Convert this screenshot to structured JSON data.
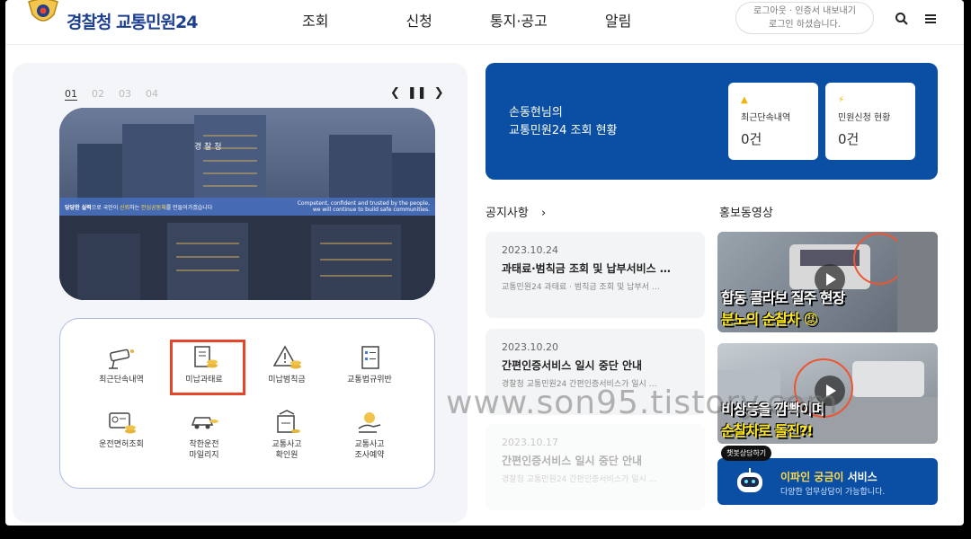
{
  "header": {
    "logo_text": "경찰청 교통민원24",
    "nav": [
      "조회",
      "신청",
      "통지·공고",
      "알림"
    ],
    "login_line1": "로그아웃 · 인증서 내보내기",
    "login_line2": "로그인 하셨습니다."
  },
  "slider": {
    "numbers": [
      "01",
      "02",
      "03",
      "04"
    ],
    "banner_building": "경 찰 청",
    "banner_left_plain1": "당당한 실력",
    "banner_left_plain2": "으로 국민이 ",
    "banner_left_hl1": "신뢰",
    "banner_left_plain3": "하는 ",
    "banner_left_hl2": "안심공동체",
    "banner_left_plain4": "를 만들어가겠습니다",
    "banner_right_1": "Competent, confident and trusted by the people,",
    "banner_right_2": "we will continue to build safe communities."
  },
  "menu": [
    {
      "l1": "최근단속내역",
      "l2": ""
    },
    {
      "l1": "미납과태료",
      "l2": ""
    },
    {
      "l1": "미납범칙금",
      "l2": ""
    },
    {
      "l1": "교통법규위반",
      "l2": ""
    },
    {
      "l1": "운전면허조회",
      "l2": ""
    },
    {
      "l1": "착한운전",
      "l2": "마일리지"
    },
    {
      "l1": "교통사고",
      "l2": "확인원"
    },
    {
      "l1": "교통사고",
      "l2": "조사예약"
    }
  ],
  "status": {
    "line1": "손동현님의",
    "line2": "교통민원24 조회 현황",
    "box1_label": "최근단속내역",
    "box1_value": "0건",
    "box2_label": "민원신청 현황",
    "box2_value": "0건"
  },
  "notices_title": "공지사항",
  "notices": [
    {
      "date": "2023.10.24",
      "title": "과태료·범칙금 조회 및 납부서비스 …",
      "summary": "교통민원24 과태료 · 범칙금 조회 및 납부서 …"
    },
    {
      "date": "2023.10.20",
      "title": "간편인증서비스 일시 중단 안내",
      "summary": "경찰청 교통민원24 간편인증서비스가 일시 …"
    },
    {
      "date": "2023.10.17",
      "title": "간편인증서비스 일시 중단 안내",
      "summary": "경찰청 교통민원24 간편인증서비스가 일시 …"
    }
  ],
  "video_title": "홍보동영상",
  "videos": [
    {
      "cap1": "합동 콜라보 질주 현장",
      "cap2": "분노의 순찰차 😡"
    },
    {
      "cap1": "비상등을 깜빡이며",
      "cap2": "순찰차로 돌진?!"
    }
  ],
  "chatbot": {
    "tag": "챗봇상담하기",
    "title_hl": "이파인 궁금이",
    "title_rest": " 서비스",
    "sub": "다양한 업무상담이 가능합니다."
  },
  "watermark": "www.son95.tistory.com"
}
